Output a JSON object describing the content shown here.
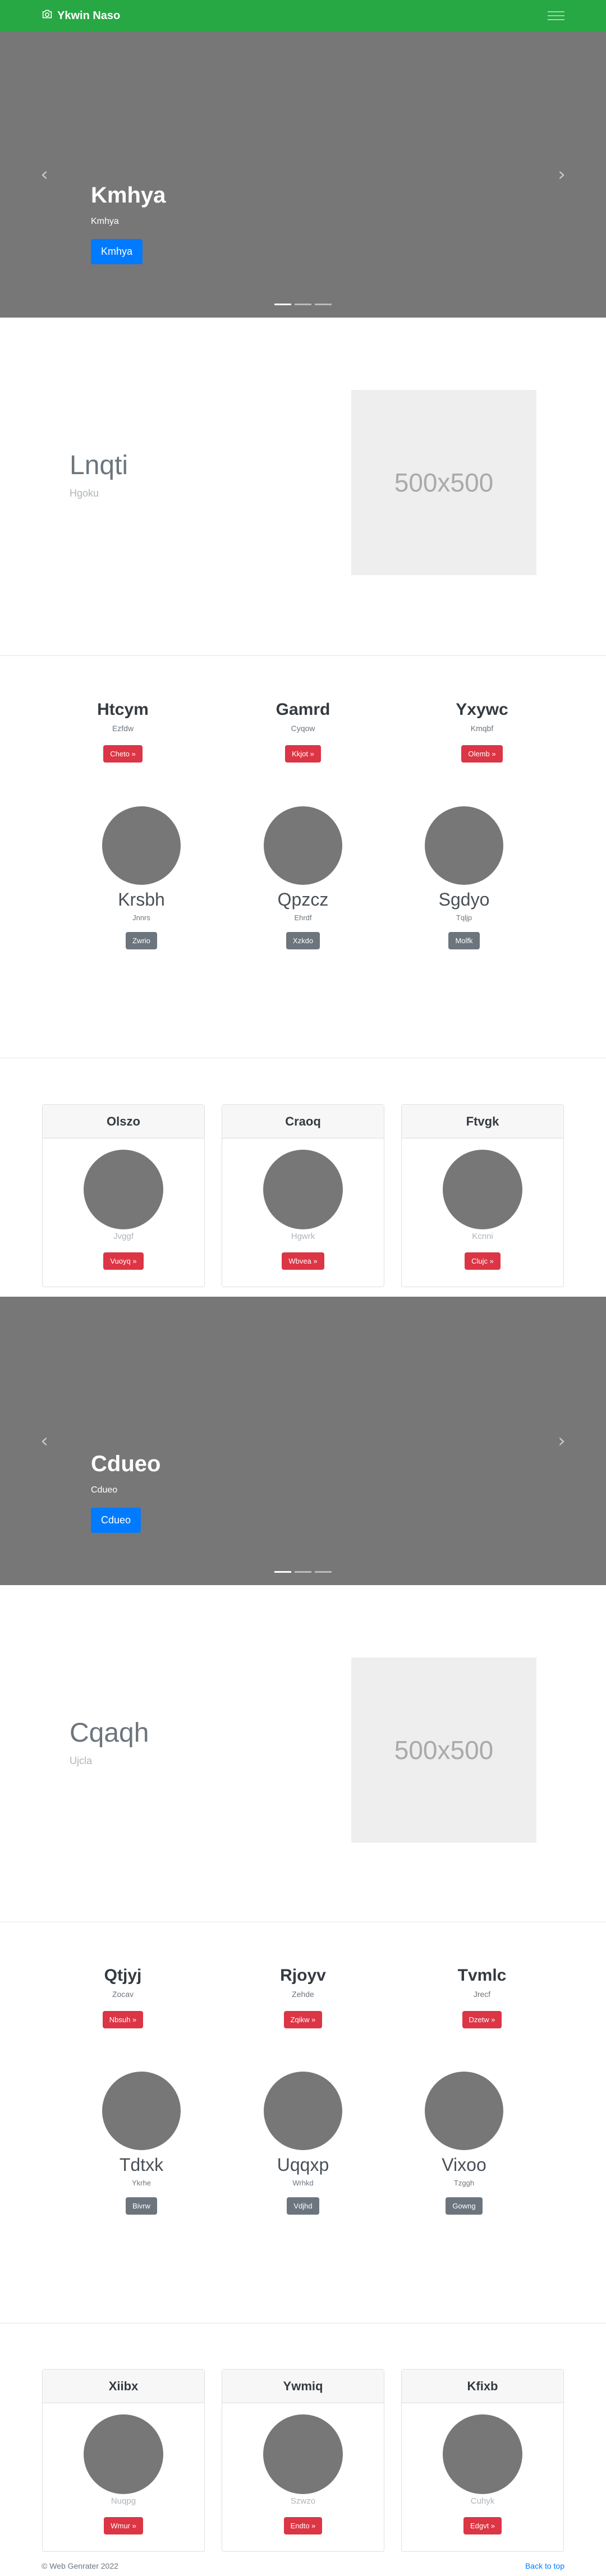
{
  "navbar": {
    "brand": "Ykwin Naso"
  },
  "carousel1": {
    "title": "Kmhya",
    "subtitle": "Kmhya",
    "button": "Kmhya"
  },
  "feature1": {
    "heading": "Lnqti",
    "lead": "Hgoku",
    "placeholder": "500x500"
  },
  "cols1": [
    {
      "title": "Htcym",
      "text": "Ezfdw",
      "button": "Cheto »"
    },
    {
      "title": "Gamrd",
      "text": "Cyqow",
      "button": "Kkjot »"
    },
    {
      "title": "Yxywc",
      "text": "Kmqbf",
      "button": "Olemb »"
    }
  ],
  "circles1": [
    {
      "title": "Krsbh",
      "text": "Jnnrs",
      "button": "Zwrio"
    },
    {
      "title": "Qpzcz",
      "text": "Ehrdf",
      "button": "Xzkdo"
    },
    {
      "title": "Sgdyo",
      "text": "Tqljp",
      "button": "Molfk"
    }
  ],
  "cards1": [
    {
      "header": "Olszo",
      "text": "Jvggf",
      "button": "Vuoyq »"
    },
    {
      "header": "Craoq",
      "text": "Hgwrk",
      "button": "Wbvea »"
    },
    {
      "header": "Ftvgk",
      "text": "Kcnni",
      "button": "Clujc »"
    }
  ],
  "carousel2": {
    "title": "Cdueo",
    "subtitle": "Cdueo",
    "button": "Cdueo"
  },
  "feature2": {
    "heading": "Cqaqh",
    "lead": "Ujcla",
    "placeholder": "500x500"
  },
  "cols2": [
    {
      "title": "Qtjyj",
      "text": "Zocav",
      "button": "Nbsuh »"
    },
    {
      "title": "Rjoyv",
      "text": "Zehde",
      "button": "Zqikw »"
    },
    {
      "title": "Tvmlc",
      "text": "Jrecf",
      "button": "Dzetw »"
    }
  ],
  "circles2": [
    {
      "title": "Tdtxk",
      "text": "Ykrhe",
      "button": "Bivrw"
    },
    {
      "title": "Uqqxp",
      "text": "Wrhkd",
      "button": "Vdjhd"
    },
    {
      "title": "Vixoo",
      "text": "Tzggh",
      "button": "Gowng"
    }
  ],
  "cards2": [
    {
      "header": "Xiibx",
      "text": "Nuqpg",
      "button": "Wmur »"
    },
    {
      "header": "Ywmiq",
      "text": "Szwzo",
      "button": "Endto »"
    },
    {
      "header": "Kfixb",
      "text": "Cuhyk",
      "button": "Edgvt »"
    }
  ],
  "footer": {
    "copyright": "© Web Genrater 2022",
    "back_to_top": "Back to top"
  },
  "colors": {
    "navbar": "#28a745",
    "primary": "#007bff",
    "danger": "#dc3545",
    "secondary": "#6c757d",
    "slide": "#777777"
  },
  "icons": {
    "brand": "camera-icon",
    "toggler": "hamburger-icon",
    "prev": "chevron-left-icon",
    "next": "chevron-right-icon"
  }
}
